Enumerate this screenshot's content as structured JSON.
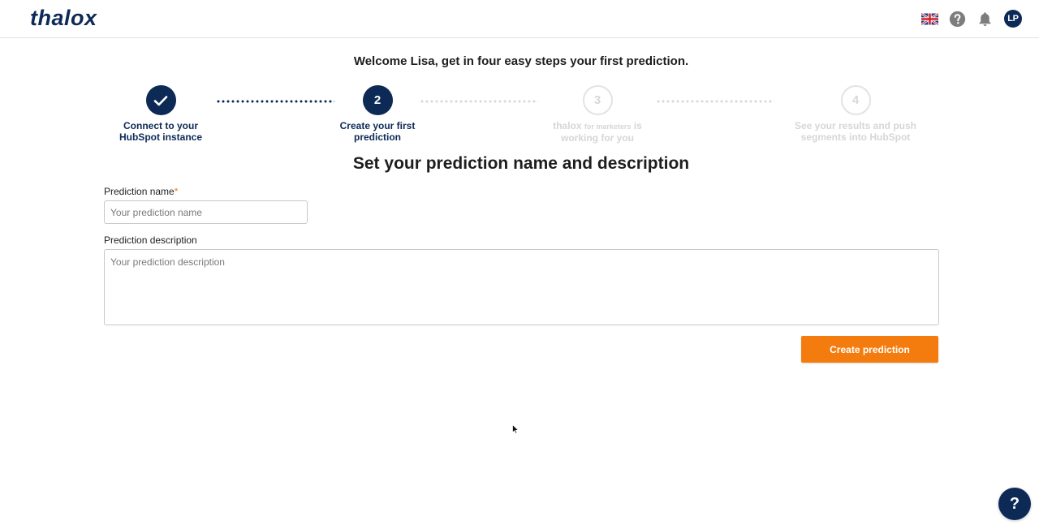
{
  "header": {
    "logo_text": "thalox",
    "language_icon": "uk-flag-icon",
    "help_icon": "question-circle-icon",
    "notifications_icon": "bell-icon",
    "avatar_initials": "LP"
  },
  "welcome": "Welcome Lisa, get in four easy steps your first prediction.",
  "stepper": {
    "steps": [
      {
        "number": "",
        "status": "done",
        "label_line1": "Connect to your",
        "label_line2": "HubSpot instance"
      },
      {
        "number": "2",
        "status": "active",
        "label_line1": "Create your first",
        "label_line2": "prediction"
      },
      {
        "number": "3",
        "status": "todo",
        "label_brand": "thalox",
        "label_brand_small": "for marketers",
        "label_brand_suffix": "is",
        "label_line2": "working for you"
      },
      {
        "number": "4",
        "status": "todo",
        "label_line1": "See your results and push",
        "label_line2": "segments into HubSpot"
      }
    ]
  },
  "subtitle": "Set your prediction name and description",
  "form": {
    "name_label": "Prediction name",
    "name_required_mark": "*",
    "name_placeholder": "Your prediction name",
    "name_value": "",
    "description_label": "Prediction description",
    "description_placeholder": "Your prediction description",
    "description_value": "",
    "submit_label": "Create prediction"
  },
  "help_button_label": "?",
  "colors": {
    "brand_navy": "#0d2a57",
    "accent_orange": "#f47c0f",
    "inactive_grey": "#d6d6d6"
  }
}
